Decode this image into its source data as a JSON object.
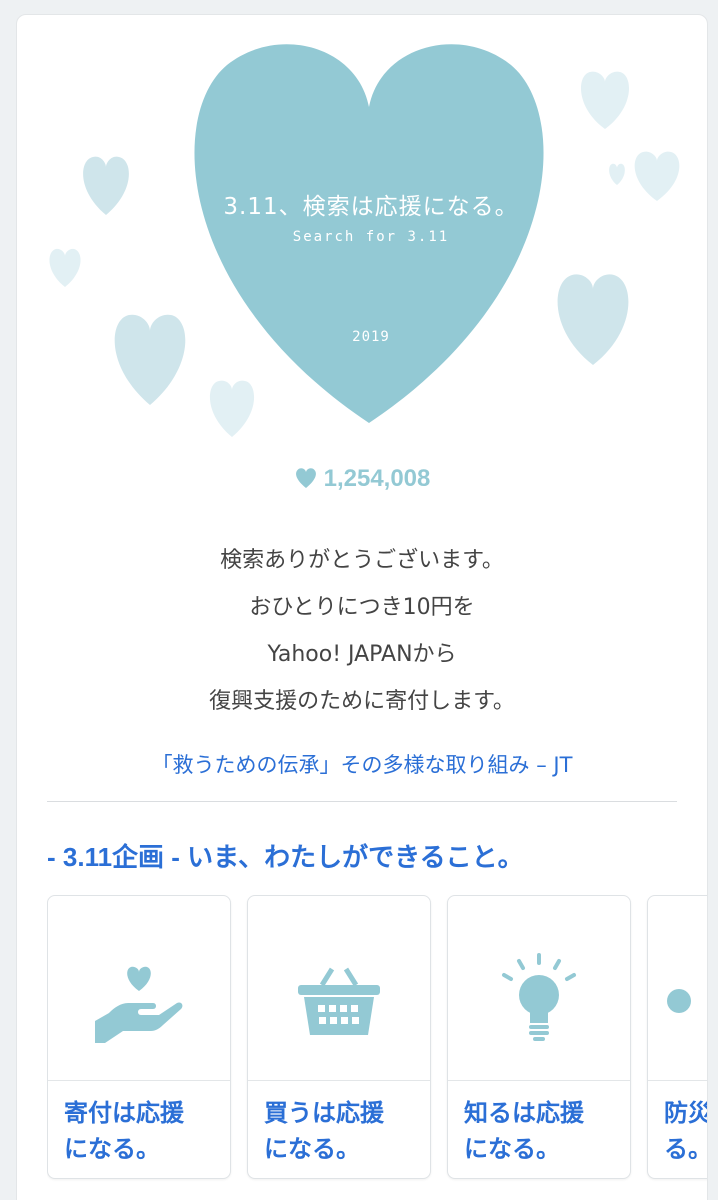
{
  "hero": {
    "title": "3.11、検索は応援になる。",
    "subtitle": "Search for 3.11",
    "year": "2019",
    "heart_color": "#93c9d4",
    "pale_heart_colors": [
      "#c9e3ea",
      "#dcedf1",
      "#e6f2f5"
    ]
  },
  "counter": {
    "icon": "heart-icon",
    "value": "1,254,008"
  },
  "message": {
    "line1": "検索ありがとうございます。",
    "line2": "おひとりにつき10円を",
    "line3": "Yahoo! JAPANから",
    "line4": "復興支援のために寄付します。"
  },
  "article_link": "「救うための伝承」その多様な取り組み – JT",
  "section": {
    "heading": "- 3.11企画 - いま、わたしができること。"
  },
  "tiles": [
    {
      "icon": "hand-heart-icon",
      "line1": "寄付は応援",
      "line2": "になる。"
    },
    {
      "icon": "basket-icon",
      "line1": "買うは応援",
      "line2": "になる。"
    },
    {
      "icon": "lightbulb-icon",
      "line1": "知るは応援",
      "line2": "になる。"
    },
    {
      "icon": "partial-icon",
      "line1": "防災",
      "line2": "る。"
    }
  ],
  "colors": {
    "accent_blue": "#2b6fd6",
    "icon_teal": "#93c9d4"
  }
}
